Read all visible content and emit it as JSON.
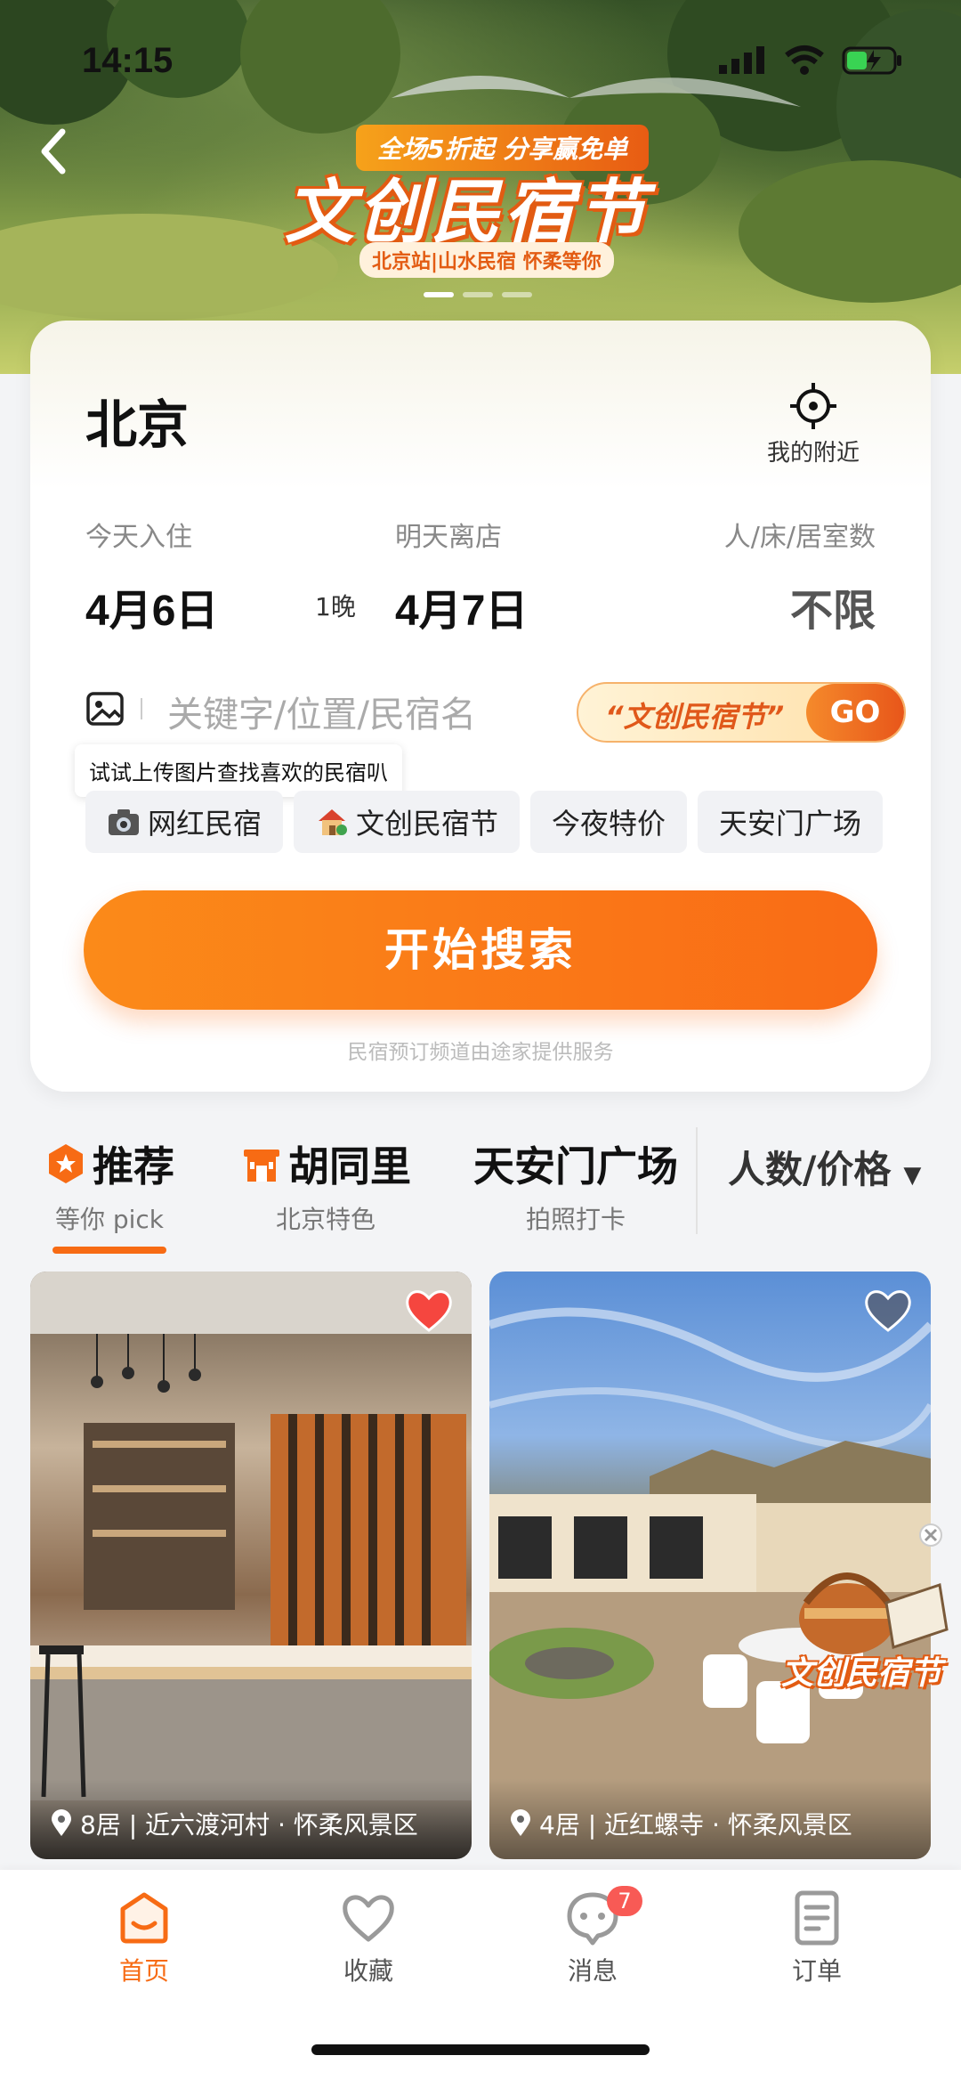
{
  "status_bar": {
    "time": "14:15"
  },
  "banner": {
    "tagline": "全场5折起 分享赢免单",
    "title": "文创民宿节",
    "subtitle": "北京站|山水民宿 怀柔等你"
  },
  "search": {
    "city": "北京",
    "nearby_label": "我的附近",
    "checkin_label": "今天入住",
    "checkin_date": "4月6日",
    "nights": "1晚",
    "checkout_label": "明天离店",
    "checkout_date": "4月7日",
    "guests_label": "人/床/居室数",
    "guests_value": "不限",
    "keyword_placeholder": "关键字/位置/民宿名",
    "promo_label": "“文创民宿节”",
    "go_label": "GO",
    "tooltip": "试试上传图片查找喜欢的民宿叭",
    "chips": [
      {
        "label": "网红民宿",
        "icon": "camera-icon"
      },
      {
        "label": "文创民宿节",
        "icon": "house-icon"
      },
      {
        "label": "今夜特价"
      },
      {
        "label": "天安门广场"
      }
    ],
    "search_button": "开始搜索",
    "provider": "民宿预订频道由途家提供服务"
  },
  "categories": {
    "items": [
      {
        "title": "推荐",
        "sub": "等你 pick"
      },
      {
        "title": "胡同里",
        "sub": "北京特色"
      },
      {
        "title": "天安门广场",
        "sub": "拍照打卡"
      }
    ],
    "filter": "人数/价格"
  },
  "listings": [
    {
      "location": "8居 | 近六渡河村 · 怀柔风景区",
      "favorited": true
    },
    {
      "location": "4居 | 近红螺寺 · 怀柔风景区",
      "favorited": false
    }
  ],
  "floating_promo": "文创民宿节",
  "tabbar": {
    "items": [
      {
        "label": "首页"
      },
      {
        "label": "收藏"
      },
      {
        "label": "消息",
        "badge": "7"
      },
      {
        "label": "订单"
      }
    ]
  },
  "colors": {
    "accent": "#f76b14",
    "heart": "#f5463f",
    "badge": "#f85a55"
  }
}
